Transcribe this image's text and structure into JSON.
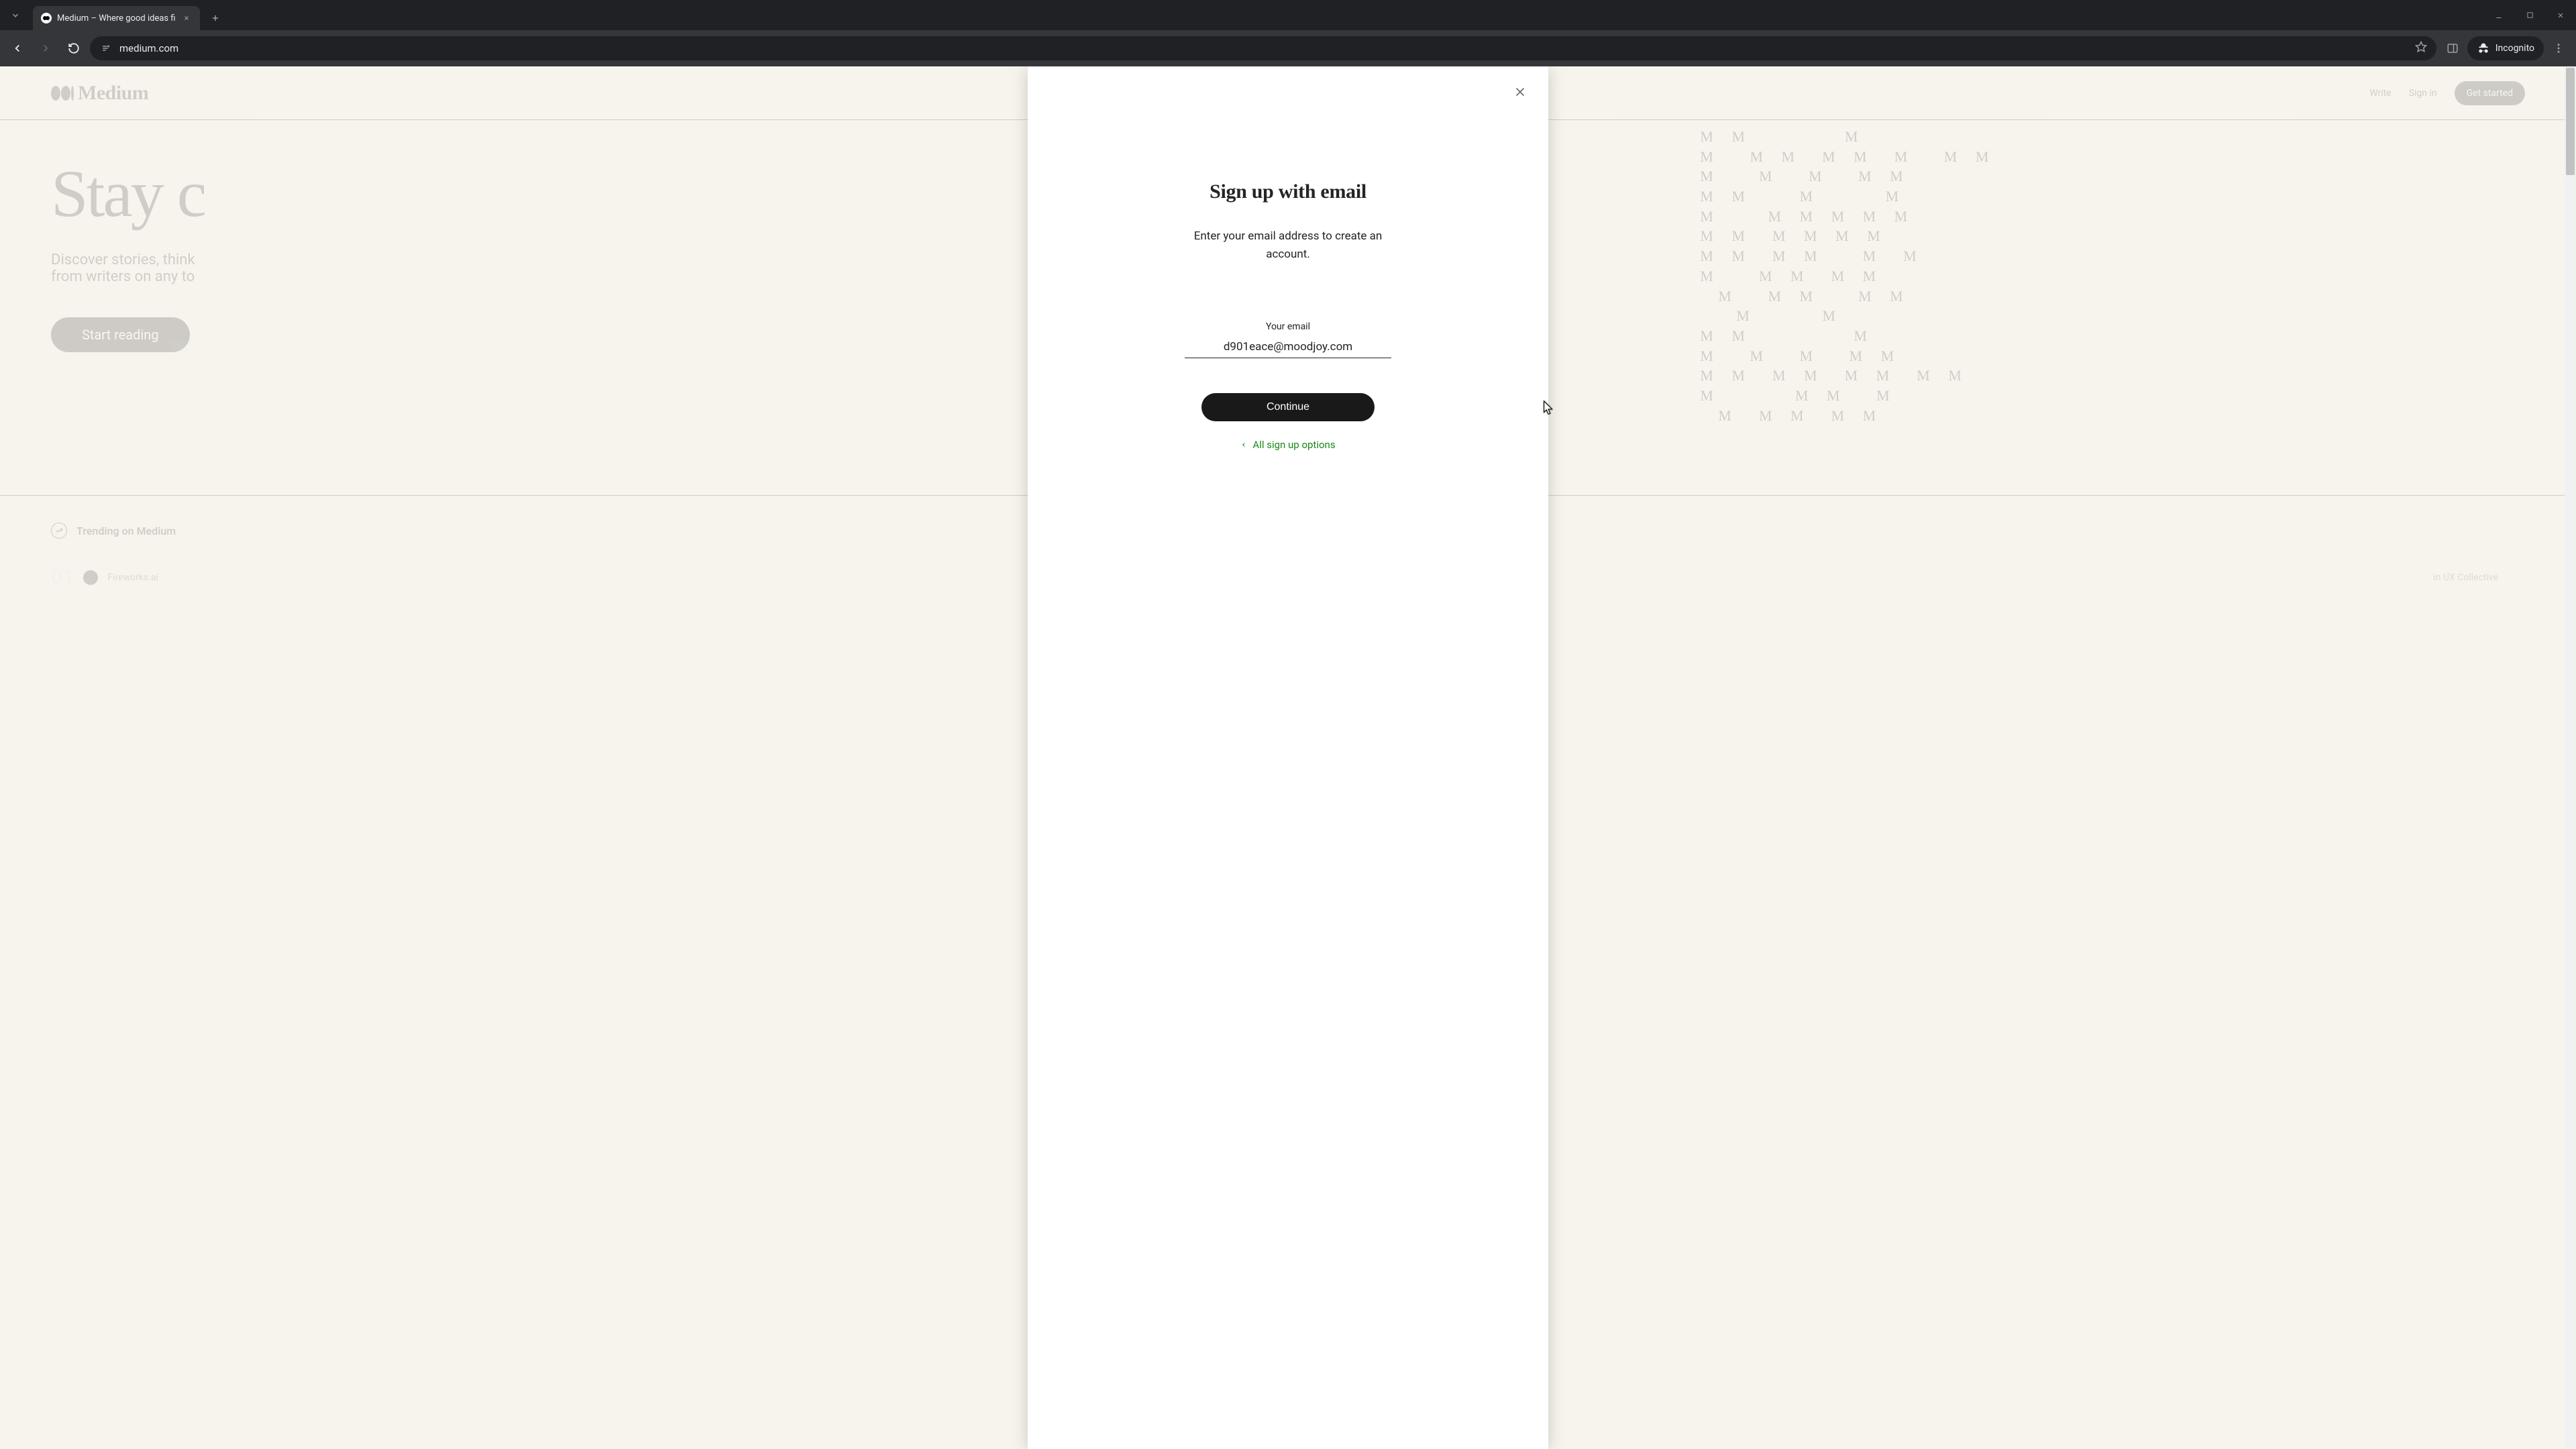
{
  "browser": {
    "tab_title": "Medium – Where good ideas fi",
    "url": "medium.com",
    "incognito_label": "Incognito"
  },
  "background": {
    "logo_text": "Medium",
    "nav": {
      "write": "Write",
      "signin": "Sign in",
      "get_started": "Get started"
    },
    "hero_title_1": "Stay c",
    "hero_sub_1": "Discover stories, think",
    "hero_sub_2": "from writers on any to",
    "start_reading": "Start reading",
    "trending_label": "Trending on Medium",
    "trending_item_num": "01",
    "trending_item_author": "Fireworks.ai",
    "trending_item_right": "in UX Collective"
  },
  "modal": {
    "title": "Sign up with email",
    "subtitle": "Enter your email address to create an account.",
    "email_label": "Your email",
    "email_value": "d901eace@moodjoy.com",
    "continue_label": "Continue",
    "back_label": "All sign up options"
  }
}
